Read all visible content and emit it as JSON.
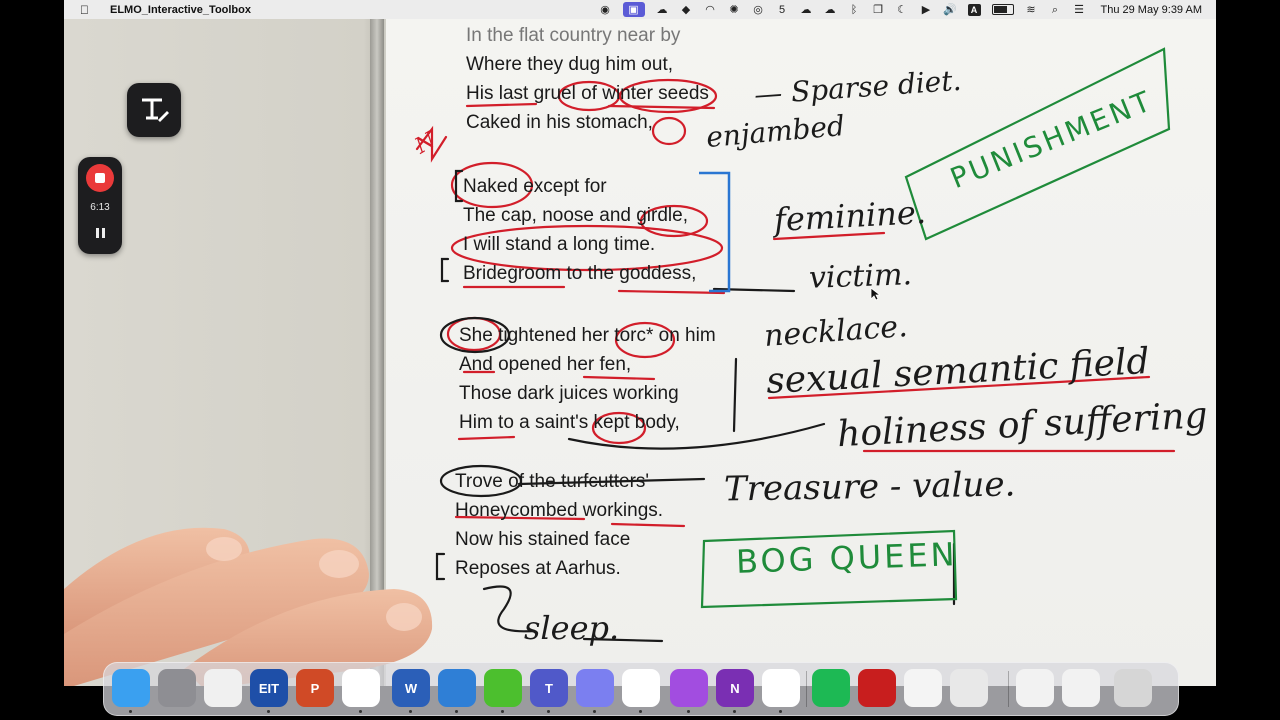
{
  "menubar": {
    "app_name": "ELMO_Interactive_Toolbox",
    "icons": [
      "screenrecorder-icon",
      "toolbox-icon",
      "cloud-app-icon",
      "dropbox-icon",
      "gauge-icon",
      "openai-icon",
      "evernote-icon",
      "five-icon",
      "creative-cloud-icon",
      "onedrive-icon",
      "bluetooth-icon",
      "window-icon",
      "moon-icon",
      "play-icon",
      "volume-icon",
      "input-a-icon",
      "battery-icon",
      "wifi-icon",
      "search-icon",
      "control-center-icon"
    ],
    "input_letter": "A",
    "clock": "Thu 29 May  9:39 AM"
  },
  "recorder": {
    "elapsed": "6:13"
  },
  "poem": {
    "stanza1": [
      "In the flat country near by",
      "Where they dug him out,",
      "His last gruel of winter seeds",
      "Caked in his stomach,"
    ],
    "stanza2": [
      "Naked except for",
      "The cap, noose and girdle,",
      "I will stand a long time.",
      "Bridegroom to the goddess,"
    ],
    "stanza3": [
      "She tightened her torc* on him",
      "And opened her fen,",
      "Those dark juices working",
      "Him to a saint's kept body,"
    ],
    "stanza4": [
      "Trove of the turfcutters'",
      "Honeycombed workings.",
      "Now his stained face",
      "Reposes at Aarhus."
    ]
  },
  "annotations": {
    "sparse": "— Sparse diet.",
    "enjambed": "enjambed",
    "punishment": "PUNISHMENT",
    "feminine": "feminine.",
    "victim": "victim.",
    "necklace": "necklace.",
    "sexual": "sexual semantic field",
    "holiness": "holiness of suffering -",
    "treasure": "Treasure - value.",
    "bog_queen": "BOG QUEEN",
    "sleep": "sleep.",
    "n_mark": "N"
  },
  "dock": {
    "items": [
      {
        "name": "finder-icon",
        "label": "",
        "color": "#3aa0f0"
      },
      {
        "name": "system-settings-icon",
        "label": "",
        "color": "#8e8e93"
      },
      {
        "name": "launchpad-icon",
        "label": "",
        "color": "#f0f0f0"
      },
      {
        "name": "elmo-toolbox-icon",
        "label": "EIT",
        "color": "#1e4fa8"
      },
      {
        "name": "powerpoint-icon",
        "label": "P",
        "color": "#d04a26"
      },
      {
        "name": "chrome-icon",
        "label": "",
        "color": "#ffffff"
      },
      {
        "name": "word-icon",
        "label": "W",
        "color": "#2b5fb8"
      },
      {
        "name": "onedrive-icon",
        "label": "",
        "color": "#2f7fd6"
      },
      {
        "name": "cloud-upload-icon",
        "label": "",
        "color": "#4cbf2e"
      },
      {
        "name": "teams-icon",
        "label": "T",
        "color": "#5059c9"
      },
      {
        "name": "spark-icon",
        "label": "",
        "color": "#7b7ff0"
      },
      {
        "name": "chatgpt-icon",
        "label": "",
        "color": "#ffffff"
      },
      {
        "name": "podcasts-icon",
        "label": "",
        "color": "#a24de0"
      },
      {
        "name": "onenote-icon",
        "label": "N",
        "color": "#7a2fb3"
      },
      {
        "name": "nordvpn-icon",
        "label": "",
        "color": "#ffffff"
      },
      {
        "name": "spotify-icon",
        "label": "",
        "color": "#1db954"
      },
      {
        "name": "acrobat-icon",
        "label": "",
        "color": "#c81e1e"
      },
      {
        "name": "textedit-icon",
        "label": "",
        "color": "#f4f4f4"
      },
      {
        "name": "printer-icon",
        "label": "",
        "color": "#e8e8e8"
      },
      {
        "name": "window-thumbnail-icon",
        "label": "",
        "color": "#f2f2f2"
      },
      {
        "name": "chrome-window-thumbnail-icon",
        "label": "",
        "color": "#f2f2f2"
      },
      {
        "name": "trash-icon",
        "label": "",
        "color": "#d6d6d6"
      }
    ]
  }
}
